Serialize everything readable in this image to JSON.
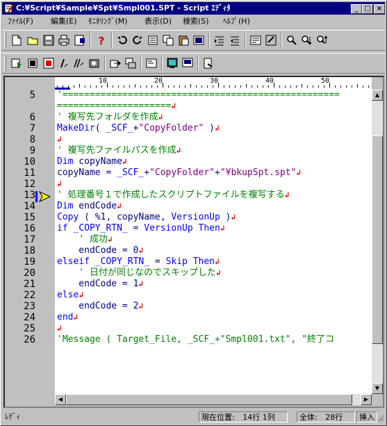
{
  "window": {
    "title": "C:¥Script¥Sample¥Spt¥Smpl001.SPT - Script ｴﾃﾞｨﾀ"
  },
  "title_buttons": {
    "minimize": "_",
    "maximize": "□",
    "close": "×"
  },
  "menu": [
    {
      "label": "ﾌｧｲﾙ(F)"
    },
    {
      "label": "編集(E)"
    },
    {
      "label": "ﾓﾆﾀﾘﾝｸﾞ(M)"
    },
    {
      "label": "表示(D)"
    },
    {
      "label": "検索(S)"
    },
    {
      "label": "ﾍﾙﾌﾟ(H)"
    }
  ],
  "colors": {
    "comment": "#008000",
    "keyword": "#0000ff",
    "string": "#800080",
    "plain": "#000080",
    "eol": "#e00000",
    "title_bar": "#000080"
  },
  "ruler": {
    "labels": [
      "10",
      "20",
      "30",
      "40",
      "50"
    ]
  },
  "line_numbers": [
    "5",
    "6",
    "7",
    "8",
    "9",
    "10",
    "11",
    "12",
    "13",
    "14",
    "15",
    "16",
    "17",
    "18",
    "19",
    "20",
    "21",
    "22",
    "23",
    "24",
    "25",
    "26"
  ],
  "code_lines": [
    {
      "segments": [
        {
          "t": "'===================================================",
          "c": "comment"
        }
      ],
      "eol": false
    },
    {
      "segments": [
        {
          "t": "=====================",
          "c": "comment"
        }
      ],
      "eol": true
    },
    {
      "segments": [
        {
          "t": "' 複写先フォルダを作成",
          "c": "comment"
        }
      ],
      "eol": true
    },
    {
      "segments": [
        {
          "t": "MakeDir",
          "c": "keyword"
        },
        {
          "t": "( ",
          "c": "plain"
        },
        {
          "t": "_SCF_",
          "c": "keyword"
        },
        {
          "t": "+",
          "c": "plain"
        },
        {
          "t": "\"CopyFolder\"",
          "c": "string"
        },
        {
          "t": " )",
          "c": "plain"
        }
      ],
      "eol": true
    },
    {
      "segments": [],
      "eol": true
    },
    {
      "segments": [
        {
          "t": "' 複写先ファイルパスを作成",
          "c": "comment"
        }
      ],
      "eol": true
    },
    {
      "segments": [
        {
          "t": "Dim",
          "c": "keyword"
        },
        {
          "t": " copyName",
          "c": "plain"
        }
      ],
      "eol": true
    },
    {
      "segments": [
        {
          "t": "copyName = ",
          "c": "plain"
        },
        {
          "t": "_SCF_",
          "c": "keyword"
        },
        {
          "t": "+",
          "c": "plain"
        },
        {
          "t": "\"CopyFolder\"",
          "c": "string"
        },
        {
          "t": "+",
          "c": "plain"
        },
        {
          "t": "\"¥bkupSpt.spt\"",
          "c": "string"
        }
      ],
      "eol": true
    },
    {
      "segments": [],
      "eol": true
    },
    {
      "segments": [
        {
          "t": "' 処理番号１で作成したスクリプトファイルを複写する",
          "c": "comment"
        }
      ],
      "eol": true
    },
    {
      "segments": [
        {
          "t": "Dim",
          "c": "keyword"
        },
        {
          "t": " endCode",
          "c": "plain"
        }
      ],
      "eol": true
    },
    {
      "segments": [
        {
          "t": "Copy",
          "c": "keyword"
        },
        {
          "t": " ( %1, copyName, ",
          "c": "plain"
        },
        {
          "t": "VersionUp",
          "c": "keyword"
        },
        {
          "t": " )",
          "c": "plain"
        }
      ],
      "eol": true
    },
    {
      "segments": [
        {
          "t": "if",
          "c": "keyword"
        },
        {
          "t": " ",
          "c": "plain"
        },
        {
          "t": "_COPY_RTN_",
          "c": "keyword"
        },
        {
          "t": " = ",
          "c": "plain"
        },
        {
          "t": "VersionUp",
          "c": "keyword"
        },
        {
          "t": " ",
          "c": "plain"
        },
        {
          "t": "Then",
          "c": "keyword"
        }
      ],
      "eol": true
    },
    {
      "segments": [
        {
          "t": "    ' 成功",
          "c": "comment"
        }
      ],
      "eol": true
    },
    {
      "segments": [
        {
          "t": "    endCode = 0",
          "c": "plain"
        }
      ],
      "eol": true
    },
    {
      "segments": [
        {
          "t": "elseif",
          "c": "keyword"
        },
        {
          "t": " ",
          "c": "plain"
        },
        {
          "t": "_COPY_RTN_",
          "c": "keyword"
        },
        {
          "t": " = ",
          "c": "plain"
        },
        {
          "t": "Skip",
          "c": "keyword"
        },
        {
          "t": " ",
          "c": "plain"
        },
        {
          "t": "Then",
          "c": "keyword"
        }
      ],
      "eol": true
    },
    {
      "segments": [
        {
          "t": "    ' 日付が同じなのでスキップした",
          "c": "comment"
        }
      ],
      "eol": true
    },
    {
      "segments": [
        {
          "t": "    endCode = 1",
          "c": "plain"
        }
      ],
      "eol": true
    },
    {
      "segments": [
        {
          "t": "else",
          "c": "keyword"
        }
      ],
      "eol": true
    },
    {
      "segments": [
        {
          "t": "    endCode = 2",
          "c": "plain"
        }
      ],
      "eol": true
    },
    {
      "segments": [
        {
          "t": "end",
          "c": "keyword"
        }
      ],
      "eol": true
    },
    {
      "segments": [],
      "eol": true
    },
    {
      "segments": [
        {
          "t": "'Message ( Target_File, ",
          "c": "comment"
        },
        {
          "t": "_SCF_+\"Smpl001.txt\", \"終了コ",
          "c": "comment"
        }
      ],
      "eol": false
    }
  ],
  "current_line": "14",
  "status": {
    "left": "ﾚﾃﾞｨ",
    "position_label": "現在位置:",
    "position_value": "14行 1列",
    "total_label": "全体:",
    "total_value": "28行",
    "mode": "挿入"
  }
}
